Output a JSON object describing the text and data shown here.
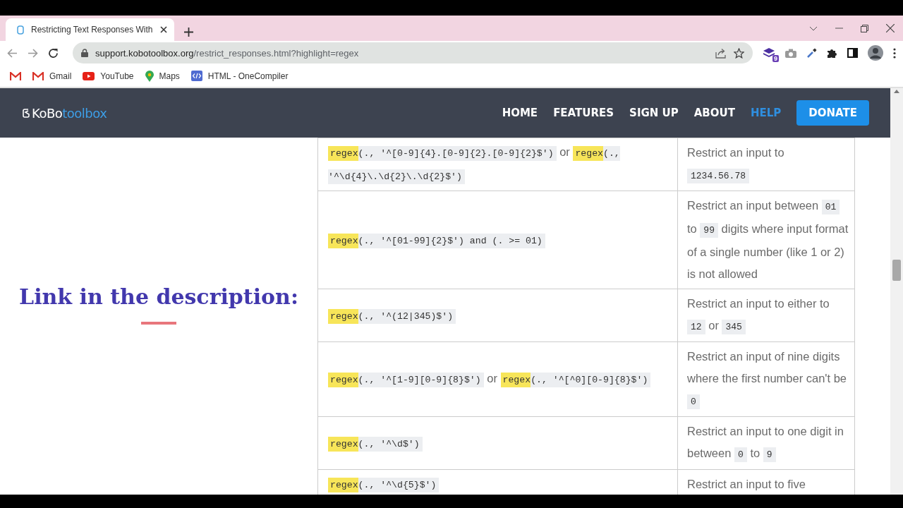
{
  "browser": {
    "tab": {
      "title": "Restricting Text Responses With",
      "selected": true
    },
    "address": {
      "host": "support.kobotoolbox.org",
      "path": "/restrict_responses.html?highlight=regex"
    },
    "extension_badge": "9",
    "bookmarks": [
      {
        "label": "Gmail",
        "kind": "gmail"
      },
      {
        "label": "YouTube",
        "kind": "youtube"
      },
      {
        "label": "Maps",
        "kind": "maps"
      },
      {
        "label": "HTML - OneCompiler",
        "kind": "code"
      }
    ]
  },
  "site": {
    "logo": {
      "first": "KoBo",
      "second": "toolbox"
    },
    "nav": [
      {
        "label": "HOME",
        "selected": false
      },
      {
        "label": "FEATURES",
        "selected": false
      },
      {
        "label": "SIGN UP",
        "selected": false
      },
      {
        "label": "ABOUT",
        "selected": false
      },
      {
        "label": "HELP",
        "selected": true
      }
    ],
    "donate": "DONATE"
  },
  "overlay": {
    "caption": "Link in the description:"
  },
  "table": {
    "rows": [
      {
        "code": [
          {
            "kind": "code",
            "highlight": "regex",
            "text": "(., '^[0-9]{4}.[0-9]{2}.[0-9]{2}$')"
          },
          {
            "kind": "text",
            "text": "or"
          },
          {
            "kind": "code",
            "highlight": "regex",
            "text": "(., '^\\d{4}\\.\\d{2}\\.\\d{2}$')"
          }
        ],
        "description": [
          {
            "kind": "text",
            "text": "Restrict an input to"
          },
          {
            "kind": "code",
            "text": "1234.56.78"
          }
        ]
      },
      {
        "code": [
          {
            "kind": "code",
            "highlight": "regex",
            "text": "(., '^[01-99]{2}$') and (. >= 01)"
          }
        ],
        "description": [
          {
            "kind": "text",
            "text": "Restrict an input between"
          },
          {
            "kind": "code",
            "text": "01"
          },
          {
            "kind": "text",
            "text": "to"
          },
          {
            "kind": "code",
            "text": "99"
          },
          {
            "kind": "text",
            "text": "digits where input format of a single number (like 1 or 2) is not allowed"
          }
        ]
      },
      {
        "code": [
          {
            "kind": "code",
            "highlight": "regex",
            "text": "(., '^(12|345)$')"
          }
        ],
        "description": [
          {
            "kind": "text",
            "text": "Restrict an input to either to"
          },
          {
            "kind": "code",
            "text": "12"
          },
          {
            "kind": "text",
            "text": "or"
          },
          {
            "kind": "code",
            "text": "345"
          }
        ]
      },
      {
        "code": [
          {
            "kind": "code",
            "highlight": "regex",
            "text": "(., '^[1-9][0-9]{8}$')"
          },
          {
            "kind": "text",
            "text": "or"
          },
          {
            "kind": "code",
            "highlight": "regex",
            "text": "(., '^[^0][0-9]{8}$')"
          }
        ],
        "description": [
          {
            "kind": "text",
            "text": "Restrict an input of nine digits where the first number can't be"
          },
          {
            "kind": "code",
            "text": "0"
          }
        ]
      },
      {
        "code": [
          {
            "kind": "code",
            "highlight": "regex",
            "text": "(., '^\\d$')"
          }
        ],
        "description": [
          {
            "kind": "text",
            "text": "Restrict an input to one digit in between"
          },
          {
            "kind": "code",
            "text": "0"
          },
          {
            "kind": "text",
            "text": "to"
          },
          {
            "kind": "code",
            "text": "9"
          }
        ]
      },
      {
        "code": [
          {
            "kind": "code",
            "highlight": "regex",
            "text": "(., '^\\d{5}$')"
          }
        ],
        "description": [
          {
            "kind": "text",
            "text": "Restrict an input to five"
          }
        ]
      }
    ]
  }
}
